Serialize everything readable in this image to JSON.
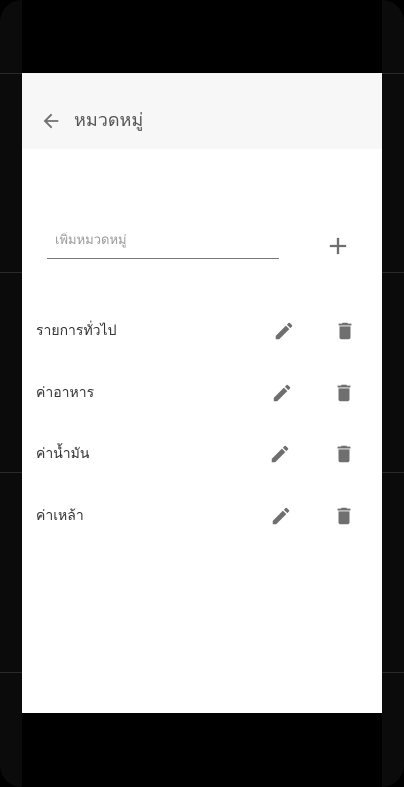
{
  "app_bar": {
    "title": "หมวดหมู่",
    "back_icon": "arrow-left-icon"
  },
  "add_category": {
    "value": "",
    "placeholder": "เพิ่มหมวดหมู่",
    "add_icon": "plus-icon"
  },
  "categories": [
    {
      "label": "รายการทั่วไป",
      "edit_icon": "pencil-icon",
      "delete_icon": "trash-icon"
    },
    {
      "label": "ค่าอาหาร",
      "edit_icon": "pencil-icon",
      "delete_icon": "trash-icon"
    },
    {
      "label": "ค่าน้ำมัน",
      "edit_icon": "pencil-icon",
      "delete_icon": "trash-icon"
    },
    {
      "label": "ค่าเหล้า",
      "edit_icon": "pencil-icon",
      "delete_icon": "trash-icon"
    }
  ],
  "colors": {
    "app_bar_bg": "#f7f7f7",
    "icon": "#6f6f6f",
    "text": "#333333",
    "screen_bg": "#ffffff"
  }
}
